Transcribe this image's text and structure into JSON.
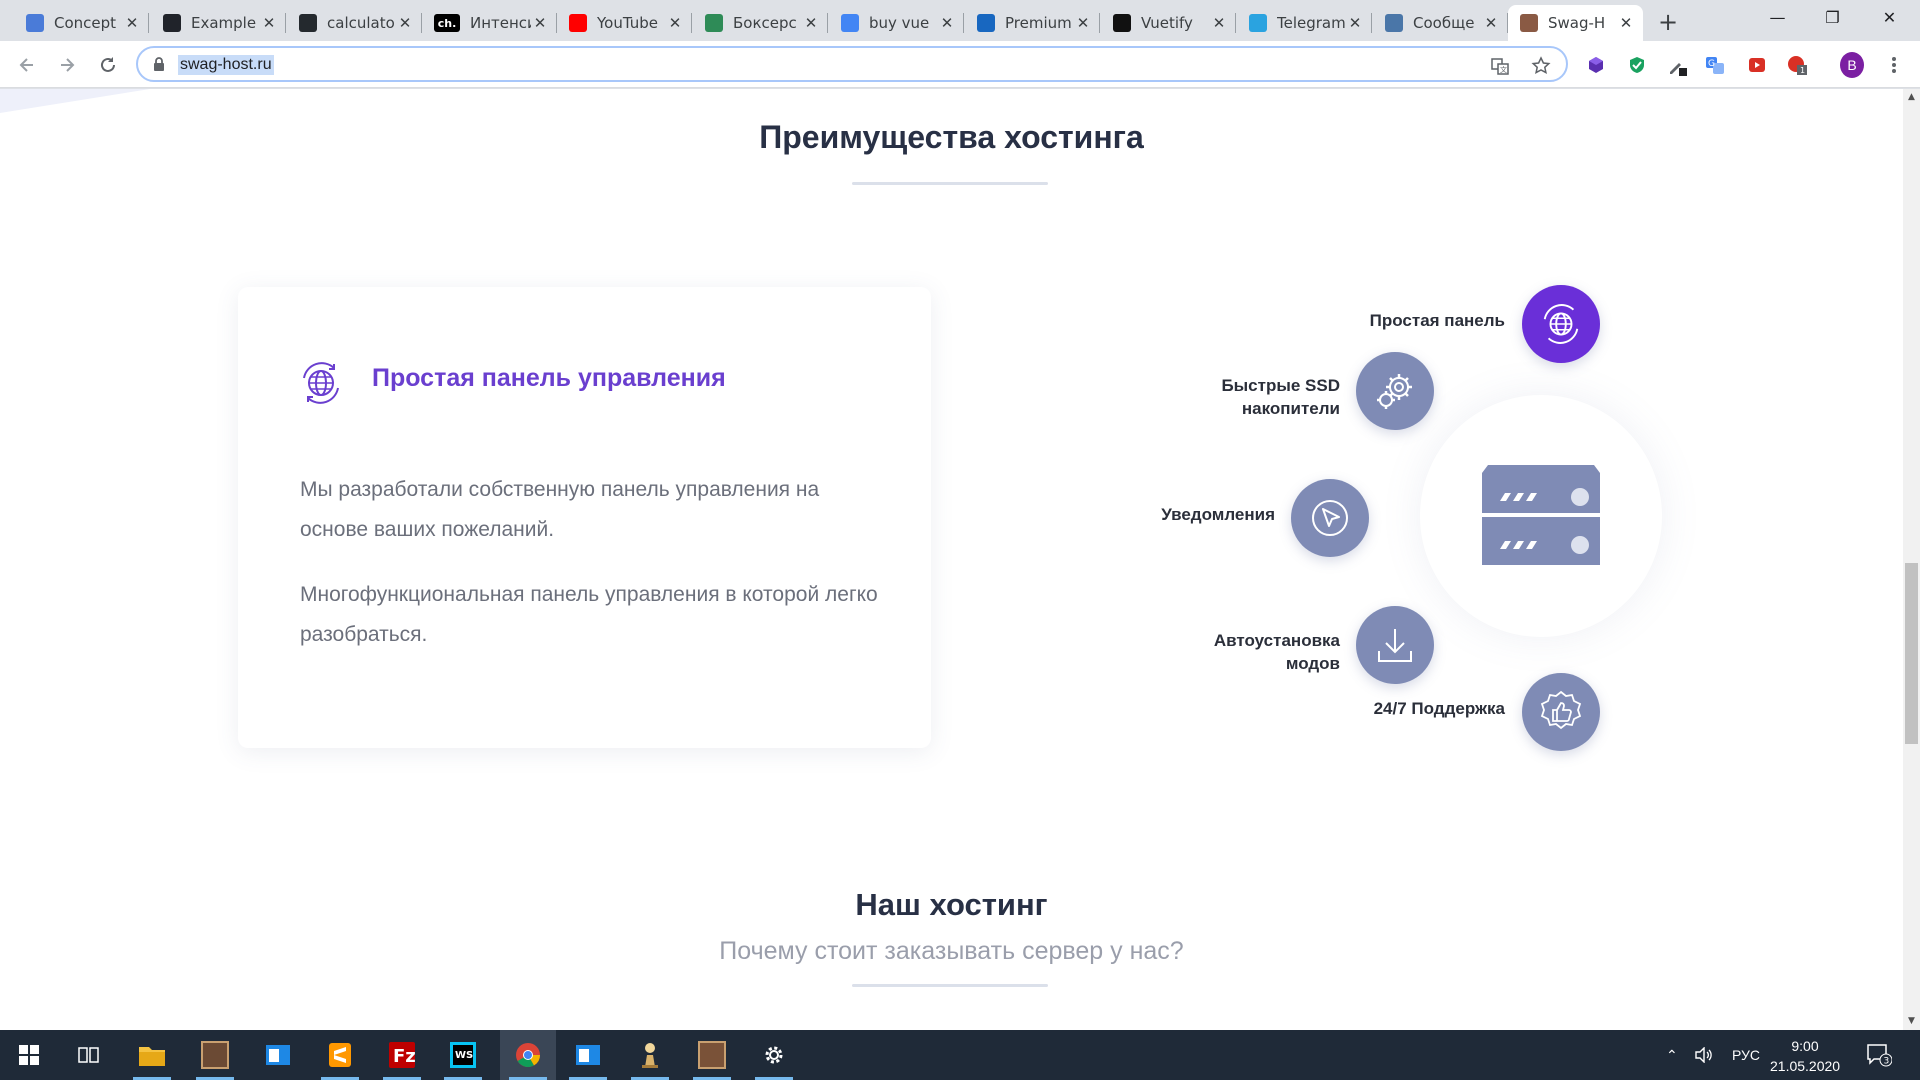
{
  "browser": {
    "tabs": [
      {
        "title": "Concept",
        "favicon": "concept-icon",
        "color": "#4a7bd8"
      },
      {
        "title": "Example",
        "favicon": "react-icon",
        "color": "#20232a"
      },
      {
        "title": "calculato",
        "favicon": "github-icon",
        "color": "#24292e"
      },
      {
        "title": "Интенси",
        "favicon": "ch-icon",
        "favicon_text": "ch.",
        "color": "#000000"
      },
      {
        "title": "YouTube",
        "favicon": "youtube-icon",
        "color": "#ff0000"
      },
      {
        "title": "Боксерс",
        "favicon": "boxer-icon",
        "color": "#2e8b57"
      },
      {
        "title": "buy vue",
        "favicon": "google-icon",
        "color": "#4285f4"
      },
      {
        "title": "Premium",
        "favicon": "vuetify-icon",
        "color": "#1867c0"
      },
      {
        "title": "Vuetify",
        "favicon": "vuetify-mask-icon",
        "color": "#111111"
      },
      {
        "title": "Telegram",
        "favicon": "telegram-icon",
        "color": "#2aa3e0"
      },
      {
        "title": "Сообще",
        "favicon": "vk-icon",
        "color": "#4a76a8"
      },
      {
        "title": "Swag-H",
        "favicon": "swag-icon",
        "color": "#8a5a44",
        "active": true
      }
    ],
    "address": "swag-host.ru",
    "profile_letter": "B",
    "extension_badge": "1"
  },
  "page": {
    "section_title": "Преимущества хостинга",
    "card": {
      "title": "Простая панель управления",
      "paragraphs": [
        "Мы разработали собственную панель управления на основе ваших пожеланий.",
        "Многофункциональная панель управления в которой легко разобраться."
      ]
    },
    "features": [
      {
        "label": "Простая панель",
        "icon": "globe-icon",
        "active": true
      },
      {
        "label": "Быстрые SSD накопители",
        "icon": "gears-icon"
      },
      {
        "label": "Уведомления",
        "icon": "cursor-icon"
      },
      {
        "label": "Автоустановка модов",
        "icon": "download-icon"
      },
      {
        "label": "24/7 Поддержка",
        "icon": "thumbs-up-icon"
      }
    ],
    "feature_lines": [
      [
        "Простая панель"
      ],
      [
        "Быстрые SSD",
        "накопители"
      ],
      [
        "Уведомления"
      ],
      [
        "Автоустановка",
        "модов"
      ],
      [
        "24/7 Поддержка"
      ]
    ],
    "second_title": "Наш хостинг",
    "second_subtitle": "Почему стоит заказывать сервер у нас?"
  },
  "colors": {
    "accent": "#6a2fd8",
    "feature_bg": "#7f8bb5",
    "title_text": "#283045",
    "card_title": "#6a3fcf"
  },
  "taskbar": {
    "tray_lang": "РУС",
    "time": "9:00",
    "date": "21.05.2020",
    "notification_count": "3"
  }
}
